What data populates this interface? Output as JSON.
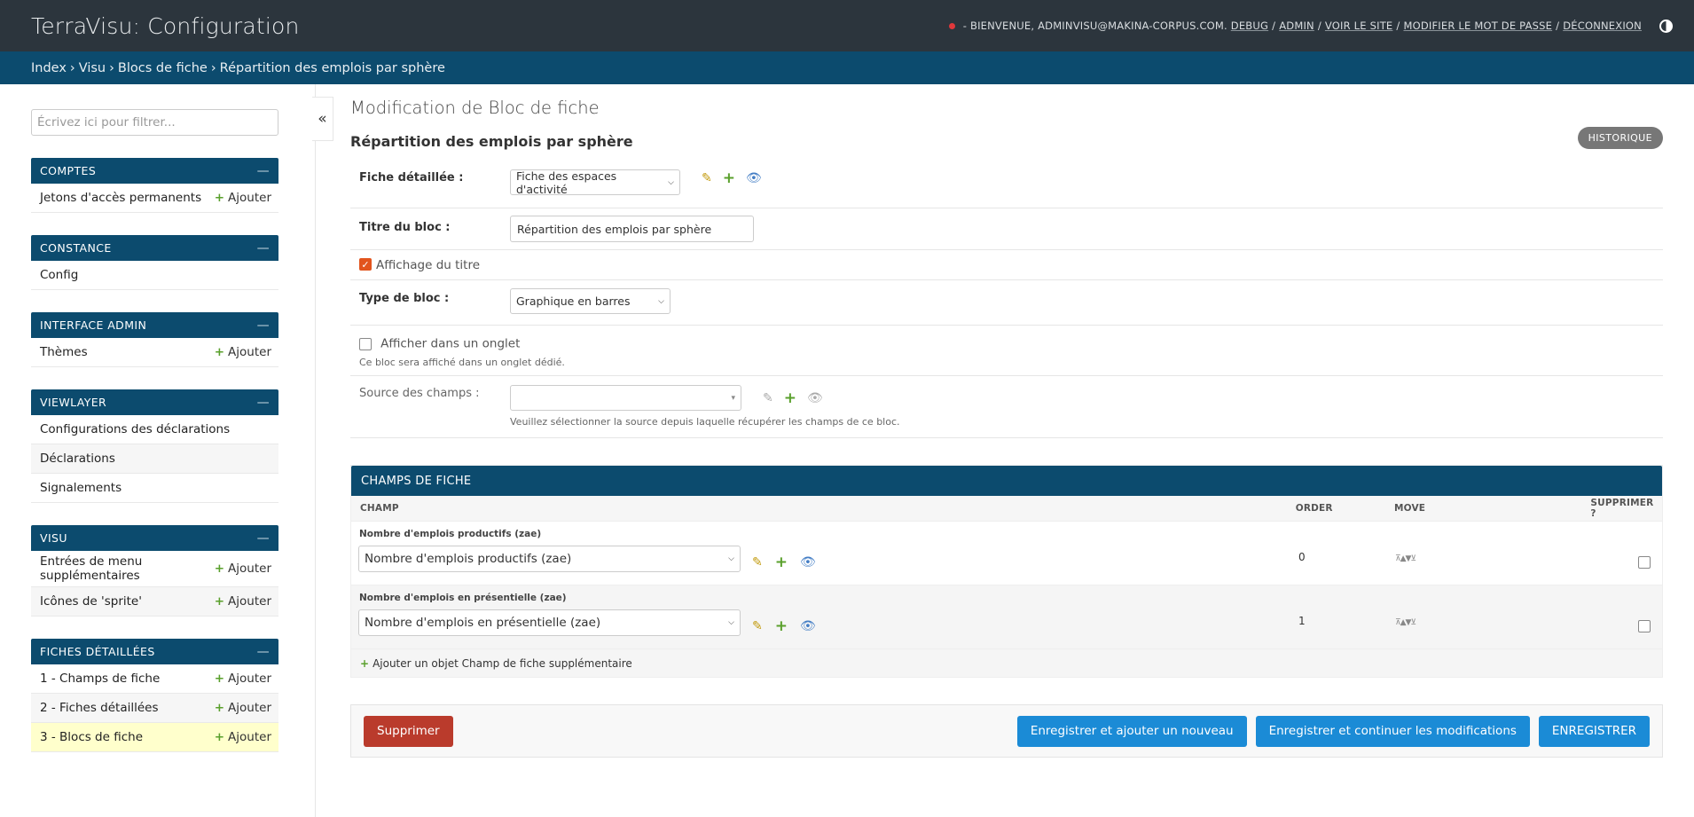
{
  "header": {
    "title": "TerraVisu: Configuration",
    "welcome": "- Bienvenue, adminvisu@makina-corpus.com.",
    "links": [
      "Debug",
      "Admin",
      "Voir le site",
      "Modifier le mot de passe",
      "Déconnexion"
    ]
  },
  "breadcrumbs": [
    "Index",
    "Visu",
    "Blocs de fiche",
    "Répartition des emplois par sphère"
  ],
  "sidebar": {
    "filter_placeholder": "Écrivez ici pour filtrer...",
    "toggle": "«",
    "add_label": "Ajouter",
    "modules": [
      {
        "title": "COMPTES",
        "items": [
          {
            "label": "Jetons d'accès permanents",
            "add": true
          }
        ]
      },
      {
        "title": "CONSTANCE",
        "items": [
          {
            "label": "Config",
            "add": false
          }
        ]
      },
      {
        "title": "INTERFACE ADMIN",
        "items": [
          {
            "label": "Thèmes",
            "add": true
          }
        ]
      },
      {
        "title": "VIEWLAYER",
        "items": [
          {
            "label": "Configurations des déclarations",
            "add": false
          },
          {
            "label": "Déclarations",
            "add": false
          },
          {
            "label": "Signalements",
            "add": false
          }
        ]
      },
      {
        "title": "VISU",
        "items": [
          {
            "label": "Entrées de menu supplémentaires",
            "add": true
          },
          {
            "label": "Icônes de 'sprite'",
            "add": true
          }
        ]
      },
      {
        "title": "FICHES DÉTAILLÉES",
        "items": [
          {
            "label": "1 - Champs de fiche",
            "add": true
          },
          {
            "label": "2 - Fiches détaillées",
            "add": true
          },
          {
            "label": "3 - Blocs de fiche",
            "add": true,
            "current": true
          }
        ]
      }
    ]
  },
  "content": {
    "heading": "Modification de Bloc de fiche",
    "object_title": "Répartition des emplois par sphère",
    "historique": "HISTORIQUE",
    "fields": {
      "fiche_label": "Fiche détaillée :",
      "fiche_value": "Fiche des espaces d'activité",
      "titre_label": "Titre du bloc :",
      "titre_value": "Répartition des emplois par sphère",
      "affichage_label": "Affichage du titre",
      "type_label": "Type de bloc :",
      "type_value": "Graphique en barres",
      "onglet_label": "Afficher dans un onglet",
      "onglet_help": "Ce bloc sera affiché dans un onglet dédié.",
      "source_label": "Source des champs :",
      "source_value": "",
      "source_help": "Veuillez sélectionner la source depuis laquelle récupérer les champs de ce bloc."
    },
    "inline": {
      "title": "CHAMPS DE FICHE",
      "columns": [
        "CHAMP",
        "ORDER",
        "MOVE",
        "SUPPRIMER ?"
      ],
      "rows": [
        {
          "label": "Nombre d'emplois productifs (zae)",
          "value": "Nombre d'emplois productifs (zae)",
          "order": "0"
        },
        {
          "label": "Nombre d'emplois en présentielle (zae)",
          "value": "Nombre d'emplois en présentielle (zae)",
          "order": "1"
        }
      ],
      "add_another": "Ajouter un objet Champ de fiche supplémentaire"
    },
    "buttons": {
      "delete": "Supprimer",
      "save_add": "Enregistrer et ajouter un nouveau",
      "save_continue": "Enregistrer et continuer les modifications",
      "save": "ENREGISTRER"
    }
  }
}
